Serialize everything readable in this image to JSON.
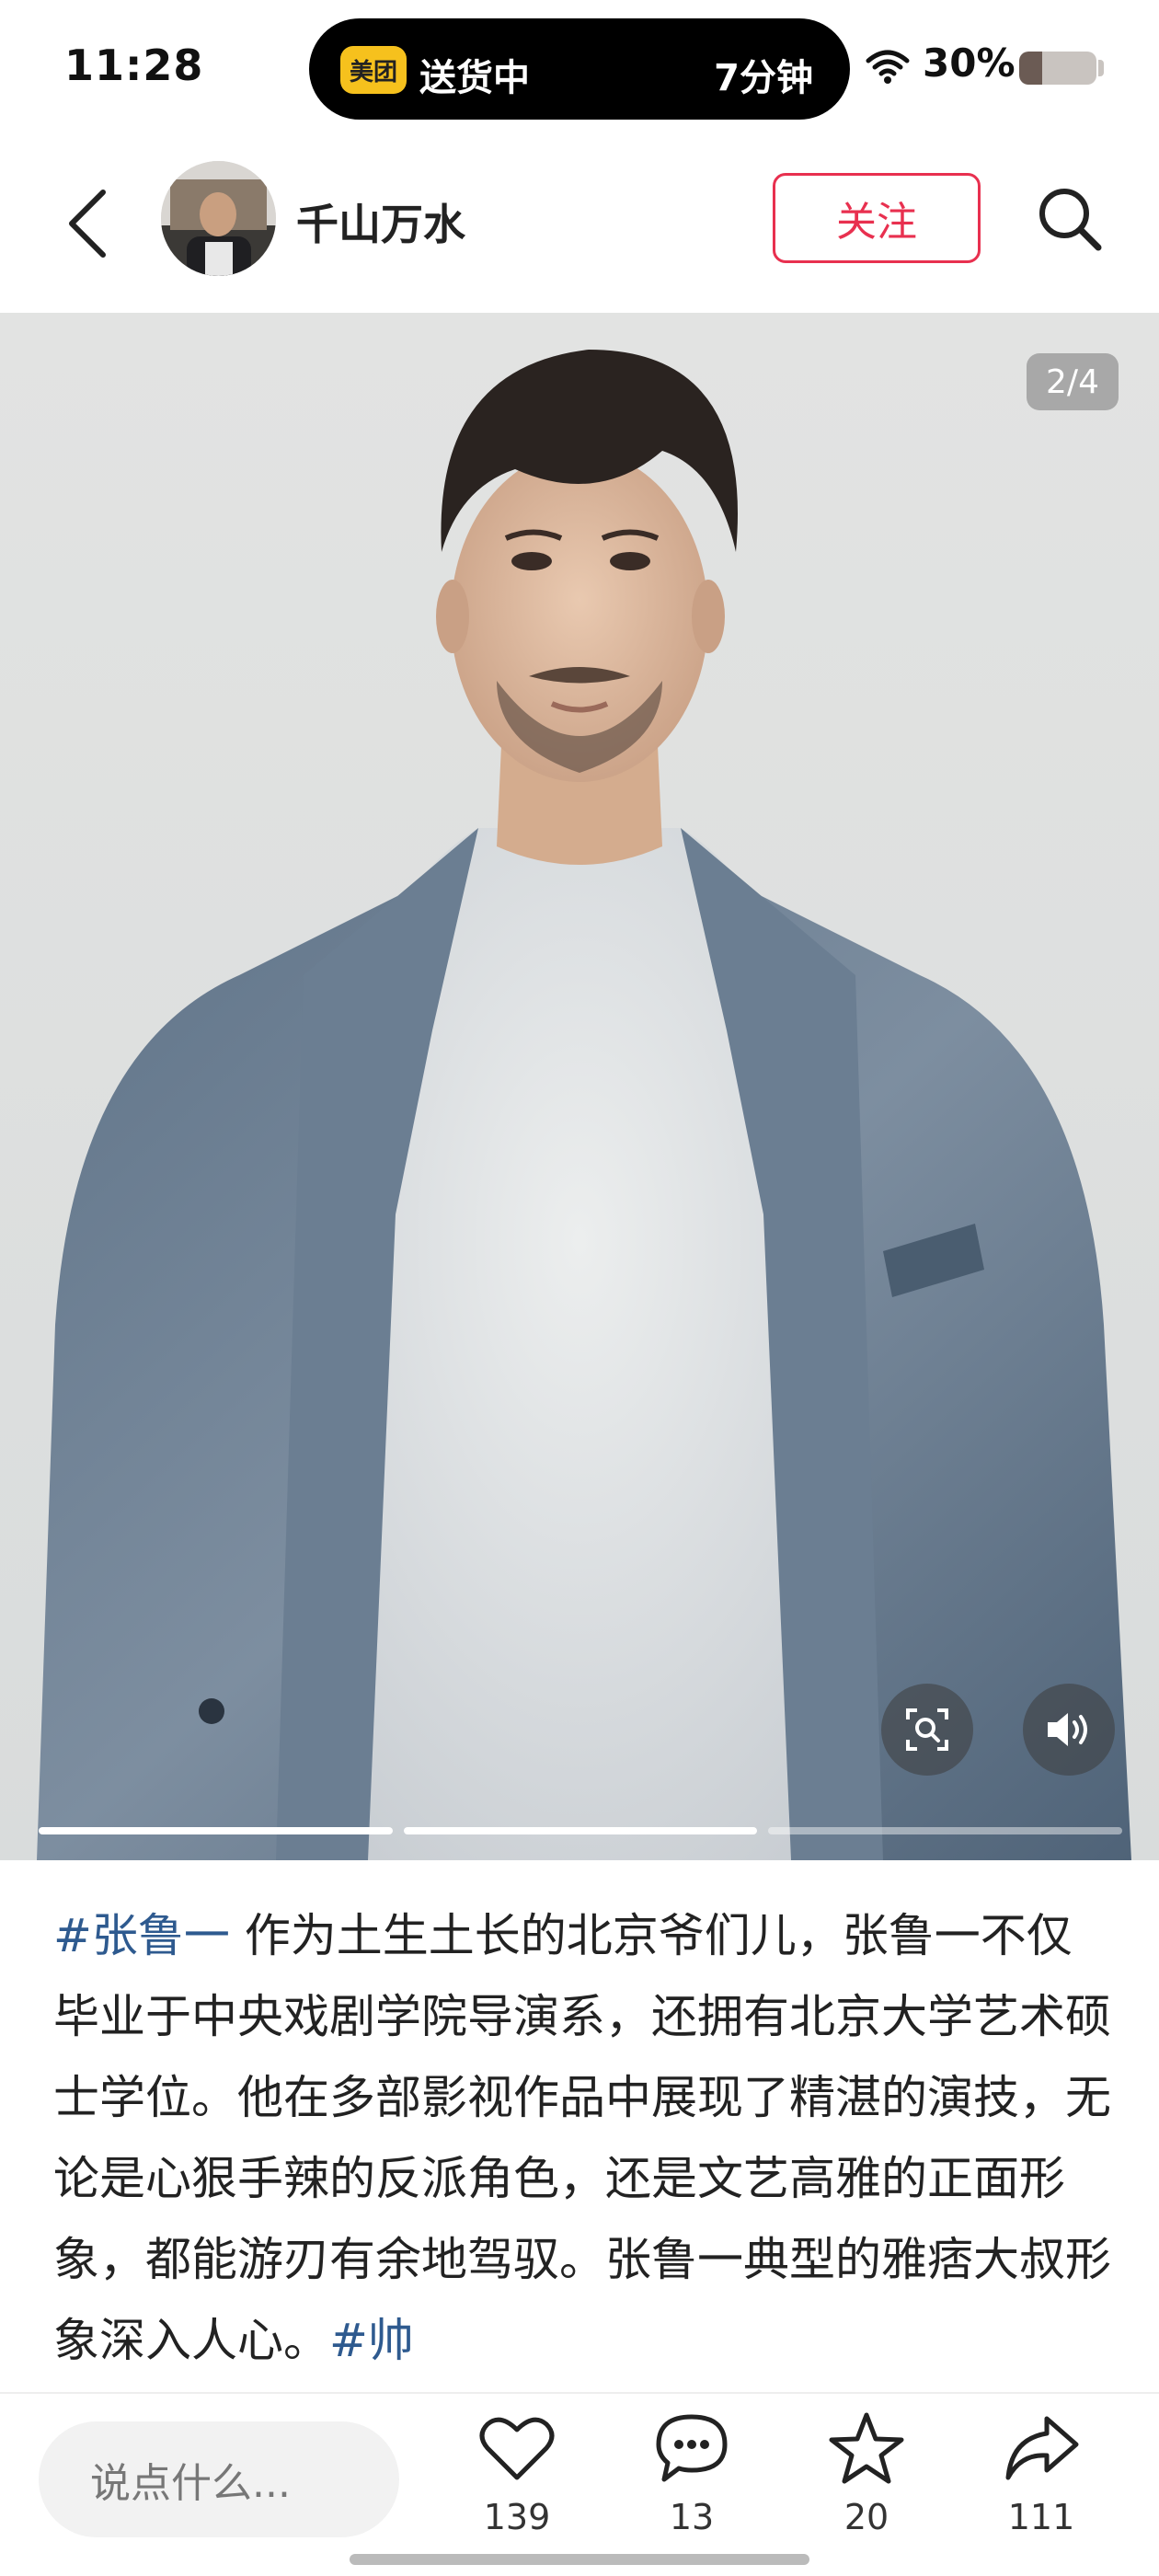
{
  "status_bar": {
    "time": "11:28",
    "island_logo": "美团",
    "island_status": "送货中",
    "island_eta": "7分钟",
    "battery_percent": "30%",
    "battery_level": 0.3,
    "wifi_icon": "wifi-icon"
  },
  "header": {
    "back_icon": "chevron-left-icon",
    "username": "千山万水",
    "follow_label": "关注",
    "search_icon": "search-icon"
  },
  "photo": {
    "page_indicator": "2/4",
    "current_page": 2,
    "total_pages": 4,
    "scan_icon": "image-search-icon",
    "sound_icon": "speaker-icon",
    "slideshow_progress": [
      1,
      1,
      0
    ]
  },
  "caption": {
    "hashtag_start": "#张鲁一",
    "text": " 作为土生土长的北京爷们儿，张鲁一不仅毕业于中央戏剧学院导演系，还拥有北京大学艺术硕士学位。他在多部影视作品中展现了精湛的演技，无论是心狠手辣的反派角色，还是文艺高雅的正面形象，都能游刃有余地驾驭。张鲁一典型的雅痞大叔形象深入人心。",
    "hashtag_end": "#帅"
  },
  "bottom_bar": {
    "comment_placeholder": "说点什么...",
    "actions": [
      {
        "icon": "heart-icon",
        "count": "139"
      },
      {
        "icon": "comment-icon",
        "count": "13"
      },
      {
        "icon": "star-icon",
        "count": "20"
      },
      {
        "icon": "share-icon",
        "count": "111"
      }
    ]
  },
  "colors": {
    "accent_red": "#e8304f",
    "hashtag_blue": "#2e5a8f",
    "island_logo_yellow": "#f6c11d"
  }
}
